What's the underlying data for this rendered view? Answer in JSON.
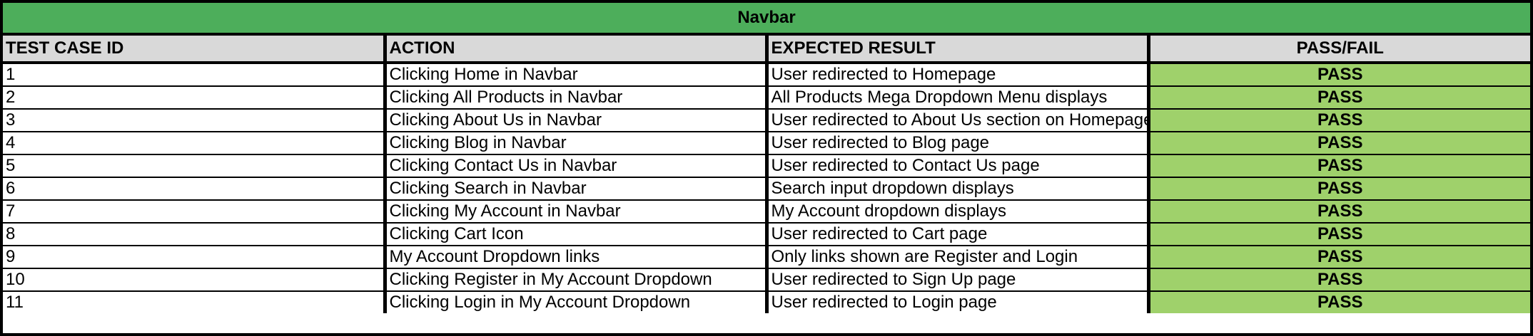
{
  "table": {
    "title": "Navbar",
    "headers": {
      "id": "TEST CASE ID",
      "action": "ACTION",
      "expected": "EXPECTED RESULT",
      "result": "PASS/FAIL"
    },
    "rows": [
      {
        "id": "1",
        "action": "Clicking Home in Navbar",
        "expected": "User redirected to Homepage",
        "result": "PASS"
      },
      {
        "id": "2",
        "action": "Clicking All Products in Navbar",
        "expected": "All Products Mega Dropdown Menu displays",
        "result": "PASS"
      },
      {
        "id": "3",
        "action": "Clicking About Us in Navbar",
        "expected": "User redirected to About Us section on Homepage",
        "result": "PASS"
      },
      {
        "id": "4",
        "action": "Clicking Blog in Navbar",
        "expected": "User redirected to Blog page",
        "result": "PASS"
      },
      {
        "id": "5",
        "action": "Clicking Contact Us in Navbar",
        "expected": "User redirected to Contact Us page",
        "result": "PASS"
      },
      {
        "id": "6",
        "action": "Clicking Search in Navbar",
        "expected": "Search input dropdown displays",
        "result": "PASS"
      },
      {
        "id": "7",
        "action": "Clicking My Account in Navbar",
        "expected": "My Account dropdown displays",
        "result": "PASS"
      },
      {
        "id": "8",
        "action": "Clicking Cart Icon",
        "expected": "User redirected to Cart page",
        "result": "PASS"
      },
      {
        "id": "9",
        "action": "My Account Dropdown links",
        "expected": "Only links shown are Register and Login",
        "result": "PASS"
      },
      {
        "id": "10",
        "action": "Clicking Register in My Account Dropdown",
        "expected": "User redirected to Sign Up page",
        "result": "PASS"
      },
      {
        "id": "11",
        "action": "Clicking Login in My Account Dropdown",
        "expected": "User redirected to Login page",
        "result": "PASS"
      }
    ]
  },
  "colors": {
    "title_bg": "#4dae5b",
    "header_bg": "#d9d9d9",
    "pass_bg": "#9fd16b",
    "border": "#000000"
  }
}
